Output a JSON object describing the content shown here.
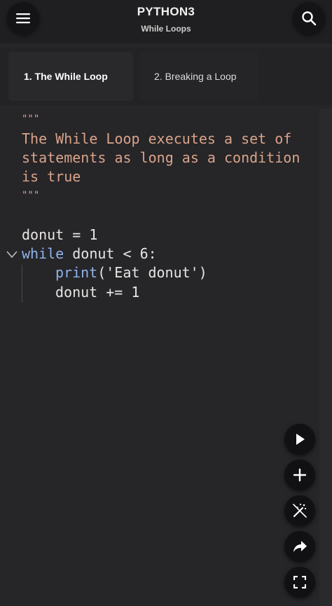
{
  "header": {
    "title": "PYTHON3",
    "subtitle": "While Loops",
    "menu_icon": "hamburger-menu-icon",
    "search_icon": "search-icon"
  },
  "tabs": [
    {
      "label": "1. The While Loop",
      "active": true
    },
    {
      "label": "2. Breaking a Loop",
      "active": false
    }
  ],
  "code": {
    "lines": [
      "\"\"\"",
      "The While Loop executes a set of",
      "statements as long as a condition",
      "is true",
      "\"\"\"",
      "",
      "donut = 1",
      "while donut < 6:",
      "    print('Eat donut')",
      "    donut += 1"
    ],
    "tokens": {
      "assign": "donut = 1",
      "while_kw": "while",
      "while_rest": " donut < 6:",
      "print_fn": "print",
      "print_arg": "('Eat donut')",
      "increment": "donut += 1"
    }
  },
  "actions": {
    "run_icon": "play-icon",
    "add_icon": "plus-icon",
    "magic_icon": "magic-wand-icon",
    "share_icon": "share-arrow-icon",
    "fullscreen_icon": "fullscreen-icon"
  },
  "colors": {
    "background": "#262528",
    "docstring": "#d9a48a",
    "keyword": "#8fb3ea",
    "text": "#e8e6e3"
  }
}
